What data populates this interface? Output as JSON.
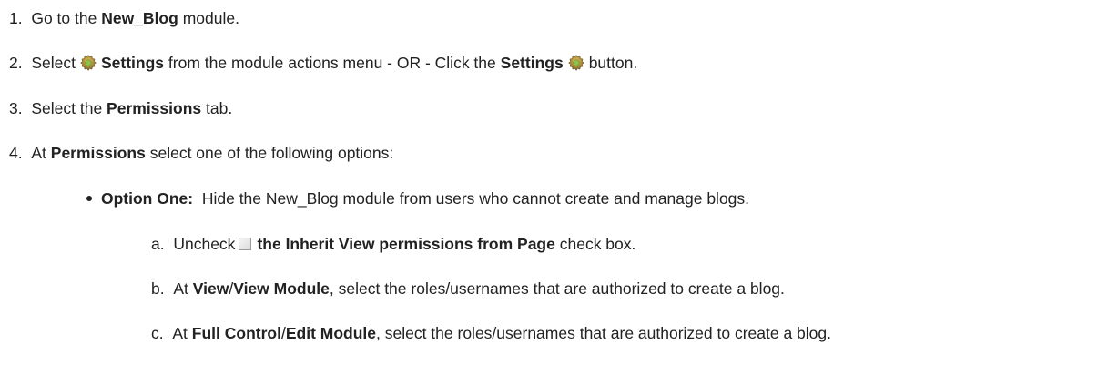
{
  "steps": [
    {
      "num": "1.",
      "pre": "Go to the",
      "bold": "New_Blog",
      "post": "module."
    },
    {
      "num": "2.",
      "pre": "Select",
      "bold1": "Settings",
      "mid": "from the module actions menu - OR - Click the",
      "bold2": "Settings",
      "post": "button.",
      "icon": "gear-icon"
    },
    {
      "num": "3.",
      "pre": "Select the",
      "bold": "Permissions",
      "post": "tab."
    },
    {
      "num": "4.",
      "pre": "At",
      "bold": "Permissions",
      "post": "select one of the following options:"
    }
  ],
  "option": {
    "bold": "Option One:",
    "text": "Hide the New_Blog module from users who cannot create and manage blogs."
  },
  "substeps": [
    {
      "letter": "a.",
      "pre": "Uncheck",
      "bold": "the",
      "bold_b": "Inherit View permissions from Page",
      "post": "check box.",
      "icon": "checkbox-icon"
    },
    {
      "letter": "b.",
      "pre": "At",
      "bold1": "View",
      "sep": "/",
      "bold2": "View Module",
      "post": ", select the roles/usernames that are authorized to create a blog."
    },
    {
      "letter": "c.",
      "pre": "At",
      "bold1": "Full Control",
      "sep": "/",
      "bold2": "Edit Module",
      "post": ", select the roles/usernames that are authorized to create a blog."
    }
  ]
}
